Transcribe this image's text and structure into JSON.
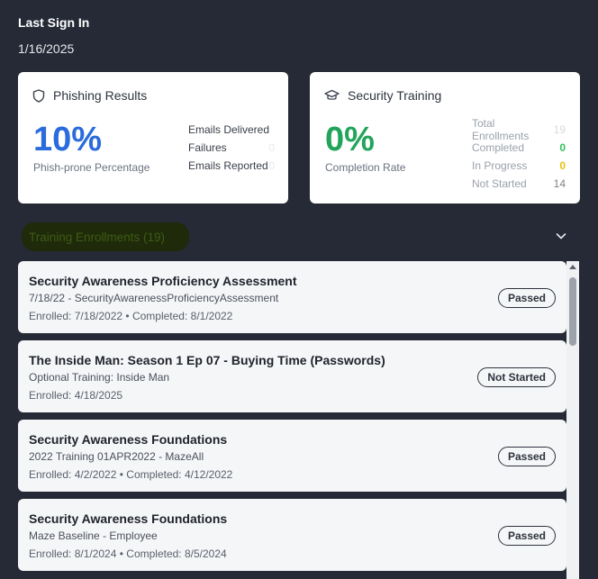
{
  "last_sign_in": {
    "label": "Last Sign In",
    "date": "1/16/2025"
  },
  "phishing": {
    "title": "Phishing Results",
    "icon": "shield-icon",
    "percent": "10%",
    "percent_label": "Phish-prone Percentage",
    "stats": [
      {
        "label": "Emails Delivered",
        "value": ""
      },
      {
        "label": "Failures",
        "value": "0"
      },
      {
        "label": "Emails Reported",
        "value": "0"
      }
    ]
  },
  "training": {
    "title": "Security Training",
    "icon": "graduation-cap-icon",
    "percent": "0%",
    "percent_label": "Completion Rate",
    "stats": [
      {
        "label": "Total Enrollments",
        "value": "19"
      },
      {
        "label": "Completed",
        "value": "0"
      },
      {
        "label": "In Progress",
        "value": "0"
      },
      {
        "label": "Not Started",
        "value": "14"
      }
    ]
  },
  "enrollments": {
    "header": "Training Enrollments (19)",
    "items": [
      {
        "title": "Security Awareness Proficiency Assessment",
        "subtitle": "7/18/22 - SecurityAwarenessProficiencyAssessment",
        "meta": "Enrolled: 7/18/2022 • Completed: 8/1/2022",
        "status": "Passed"
      },
      {
        "title": "The Inside Man: Season 1 Ep 07 - Buying Time (Passwords)",
        "subtitle": "Optional Training: Inside Man",
        "meta": "Enrolled: 4/18/2025",
        "status": "Not Started"
      },
      {
        "title": "Security Awareness Foundations",
        "subtitle": "2022 Training 01APR2022 - MazeAll",
        "meta": "Enrolled: 4/2/2022 • Completed: 4/12/2022",
        "status": "Passed"
      },
      {
        "title": "Security Awareness Foundations",
        "subtitle": "Maze Baseline - Employee",
        "meta": "Enrolled: 8/1/2024 • Completed: 8/5/2024",
        "status": "Passed"
      }
    ]
  },
  "colors": {
    "background": "#252a36",
    "accent_blue": "#2b6bdc",
    "accent_green": "#22a45a",
    "in_progress_yellow": "#e8c20a"
  }
}
